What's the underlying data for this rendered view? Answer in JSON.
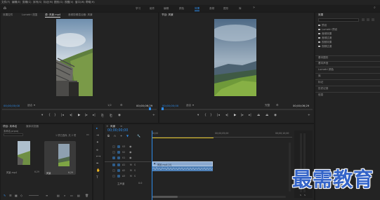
{
  "menu": [
    "文件(F)",
    "编辑(E)",
    "剪辑(C)",
    "序列(S)",
    "标记(M)",
    "图形(G)",
    "视图(V)",
    "窗口(W)",
    "帮助(H)"
  ],
  "workspaces": [
    "学习",
    "组件",
    "编辑",
    "颜色",
    "效果",
    "音频",
    "图形",
    "库"
  ],
  "workspace_active": "效果",
  "source_tabs": [
    "效果控件",
    "Lumetri 范围",
    "源: 风景.mp4",
    "音频剪辑混合器: 风景"
  ],
  "source_active": "源: 风景.mp4",
  "source_timecode_in": "00;00;00;00",
  "source_fit": "适合",
  "source_fraction": "1/2",
  "source_timecode_out": "00;00;06;29",
  "program_tabs": [
    "节目: 风景"
  ],
  "program_timecode_in": "00;00;00;00",
  "program_fit": "适合",
  "program_fraction": "完整",
  "program_timecode_out": "00;00;06;29",
  "effects": {
    "title": "效果",
    "folders": [
      "预设",
      "Lumetri 预设",
      "音频效果",
      "音频过渡",
      "视频效果",
      "视频过渡"
    ],
    "panels": [
      "基本图形",
      "基本声音",
      "Lumetri 颜色",
      "库",
      "标记",
      "历史记录",
      "信息"
    ]
  },
  "project": {
    "tabs": [
      "项目: 未命名",
      "媒体浏览器"
    ],
    "file": "未命名.prproj",
    "status": "1 项已选择, 共 2 项",
    "items": [
      {
        "name": "风景.mp4",
        "duration": "6;29"
      },
      {
        "name": "风景",
        "duration": "6;29"
      }
    ]
  },
  "timeline": {
    "tab": "风景",
    "timecode": "00;00;00;00",
    "ruler": [
      "00;00",
      "00;00;05;00",
      "00;00;10;00"
    ],
    "tracks": [
      "V3",
      "V2",
      "V1",
      "A1",
      "A2",
      "A3"
    ],
    "master": "主声道",
    "master_value": "0.0",
    "clip_video": "风景.mp4 [V]",
    "clip_audio": ""
  },
  "watermark": "最需教育",
  "colors": {
    "accent": "#2d8ceb",
    "clip_video": "#8aa9cf",
    "clip_audio": "#4e7fb5",
    "watermark": "#3464c8"
  }
}
